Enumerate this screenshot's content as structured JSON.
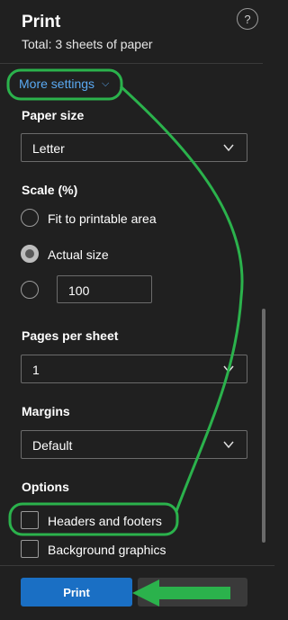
{
  "header": {
    "title": "Print",
    "subtitle": "Total: 3 sheets of paper",
    "help_label": "?"
  },
  "more_settings": {
    "label": "More settings",
    "chevron": "⌵"
  },
  "paper_size": {
    "label": "Paper size",
    "value": "Letter"
  },
  "scale": {
    "label": "Scale (%)",
    "options": [
      {
        "label": "Fit to printable area",
        "checked": false
      },
      {
        "label": "Actual size",
        "checked": true
      }
    ],
    "custom_value": "100"
  },
  "pages_per_sheet": {
    "label": "Pages per sheet",
    "value": "1"
  },
  "margins": {
    "label": "Margins",
    "value": "Default"
  },
  "options": {
    "label": "Options",
    "items": [
      {
        "label": "Headers and footers",
        "checked": false
      },
      {
        "label": "Background graphics",
        "checked": false
      }
    ]
  },
  "footer": {
    "print_label": "Print",
    "cancel_label": ""
  },
  "colors": {
    "background": "#202020",
    "link": "#5aa9f2",
    "primary_button": "#1a6fc4",
    "annotation": "#2bb24c"
  },
  "icons": {
    "help": "question-mark-circle-icon",
    "dropdown": "chevron-down-icon",
    "annotation_arrow": "green-arrow-icon"
  }
}
